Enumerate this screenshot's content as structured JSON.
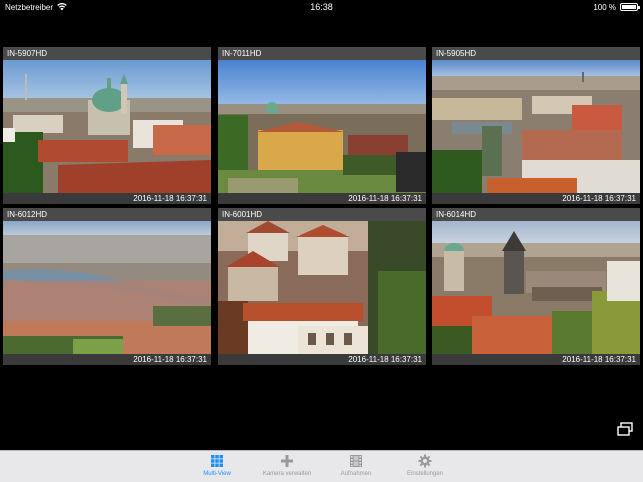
{
  "status_bar": {
    "carrier": "Netzbetreiber",
    "time": "16:38",
    "battery": "100 %"
  },
  "cameras": [
    {
      "name": "IN-5907HD",
      "timestamp": "2016-11-18 16:37:31"
    },
    {
      "name": "IN-7011HD",
      "timestamp": "2016-11-18 16:37:31"
    },
    {
      "name": "IN-5905HD",
      "timestamp": "2016-11-18 16:37:31"
    },
    {
      "name": "IN-6012HD",
      "timestamp": "2016-11-18 16:37:31"
    },
    {
      "name": "IN-6001HD",
      "timestamp": "2016-11-18 16:37:31"
    },
    {
      "name": "IN-6014HD",
      "timestamp": "2016-11-18 16:37:31"
    }
  ],
  "tab_bar": {
    "items": [
      {
        "label": "Multi-View",
        "icon": "grid-icon",
        "active": true
      },
      {
        "label": "Kamera verwalten",
        "icon": "plus-icon",
        "active": false
      },
      {
        "label": "Aufnahmen",
        "icon": "film-icon",
        "active": false
      },
      {
        "label": "Einstellungen",
        "icon": "gear-icon",
        "active": false
      }
    ]
  },
  "colors": {
    "accent": "#1e8ff5",
    "tab_inactive": "#9a9a9a",
    "tile_header": "#4a4a4a",
    "background": "#000000"
  }
}
